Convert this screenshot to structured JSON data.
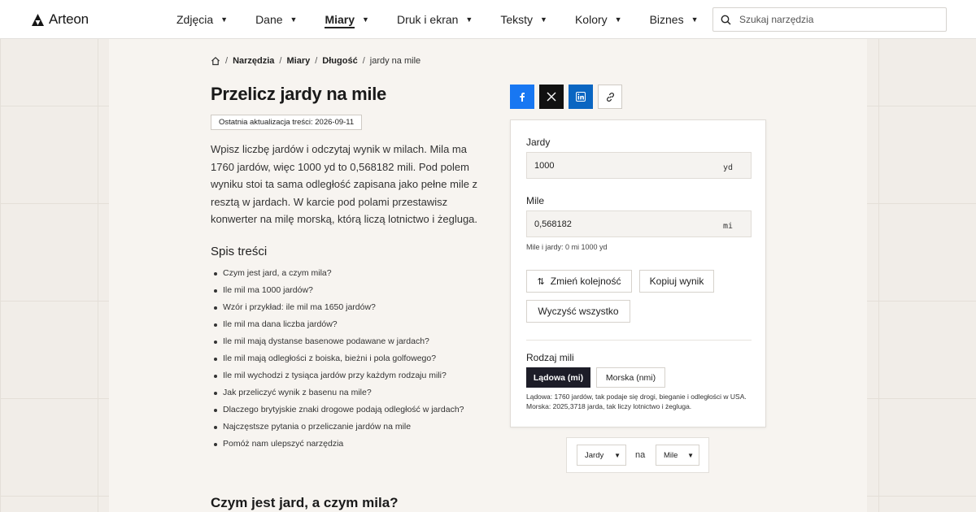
{
  "brand": {
    "name": "Arteon"
  },
  "nav": {
    "items": [
      {
        "label": "Zdjęcia",
        "active": false
      },
      {
        "label": "Dane",
        "active": false
      },
      {
        "label": "Miary",
        "active": true
      },
      {
        "label": "Druk i ekran",
        "active": false
      },
      {
        "label": "Teksty",
        "active": false
      },
      {
        "label": "Kolory",
        "active": false
      },
      {
        "label": "Biznes",
        "active": false
      }
    ]
  },
  "search": {
    "placeholder": "Szukaj narzędzia",
    "icon": "search-icon"
  },
  "breadcrumb": {
    "home_icon": "home-icon",
    "items": [
      "Narzędzia",
      "Miary",
      "Długość"
    ],
    "current": "jardy na mile"
  },
  "page": {
    "title": "Przelicz jardy na mile",
    "updated": "Ostatnia aktualizacja treści: 2026-09-11",
    "intro": "Wpisz liczbę jardów i odczytaj wynik w milach. Mila ma 1760 jardów, więc 1000 yd to 0,568182 mili. Pod polem wyniku stoi ta sama odległość zapisana jako pełne mile z resztą w jardach. W karcie pod polami przestawisz konwerter na milę morską, którą liczą lotnictwo i żegluga.",
    "toc_title": "Spis treści",
    "toc": [
      "Czym jest jard, a czym mila?",
      "Ile mil ma 1000 jardów?",
      "Wzór i przykład: ile mil ma 1650 jardów?",
      "Ile mil ma dana liczba jardów?",
      "Ile mil mają dystanse basenowe podawane w jardach?",
      "Ile mil mają odległości z boiska, bieżni i pola golfowego?",
      "Ile mil wychodzi z tysiąca jardów przy każdym rodzaju mili?",
      "Jak przeliczyć wynik z basenu na mile?",
      "Dlaczego brytyjskie znaki drogowe podają odległość w jardach?",
      "Najczęstsze pytania o przeliczanie jardów na mile",
      "Pomóż nam ulepszyć narzędzia"
    ],
    "section_title": "Czym jest jard, a czym mila?"
  },
  "share": {
    "icons": [
      "facebook-icon",
      "x-icon",
      "linkedin-icon",
      "link-icon"
    ],
    "colors": {
      "facebook": "#1877f2",
      "x": "#111111",
      "linkedin": "#0a66c2"
    }
  },
  "converter": {
    "from_label": "Jardy",
    "from_value": "1000",
    "from_unit": "yd",
    "to_label": "Mile",
    "to_value": "0,568182",
    "to_unit": "mi",
    "mixed": "Mile i jardy: 0 mi 1000 yd",
    "swap_label": "Zmień kolejność",
    "copy_label": "Kopiuj wynik",
    "clear_label": "Wyczyść wszystko",
    "mile_type_label": "Rodzaj mili",
    "mile_options": [
      {
        "label": "Lądowa (mi)",
        "selected": true
      },
      {
        "label": "Morska (nmi)",
        "selected": false
      }
    ],
    "note": "Lądowa: 1760 jardów, tak podaje się drogi, bieganie i odległości w USA. Morska: 2025,3718 jarda, tak liczy lotnictwo i żegluga."
  },
  "unit_selector": {
    "from": "Jardy",
    "connector": "na",
    "to": "Mile"
  },
  "colors": {
    "accent_dark": "#1d1d28",
    "page_bg": "#f1ede8",
    "panel_bg": "#f7f4f0"
  }
}
